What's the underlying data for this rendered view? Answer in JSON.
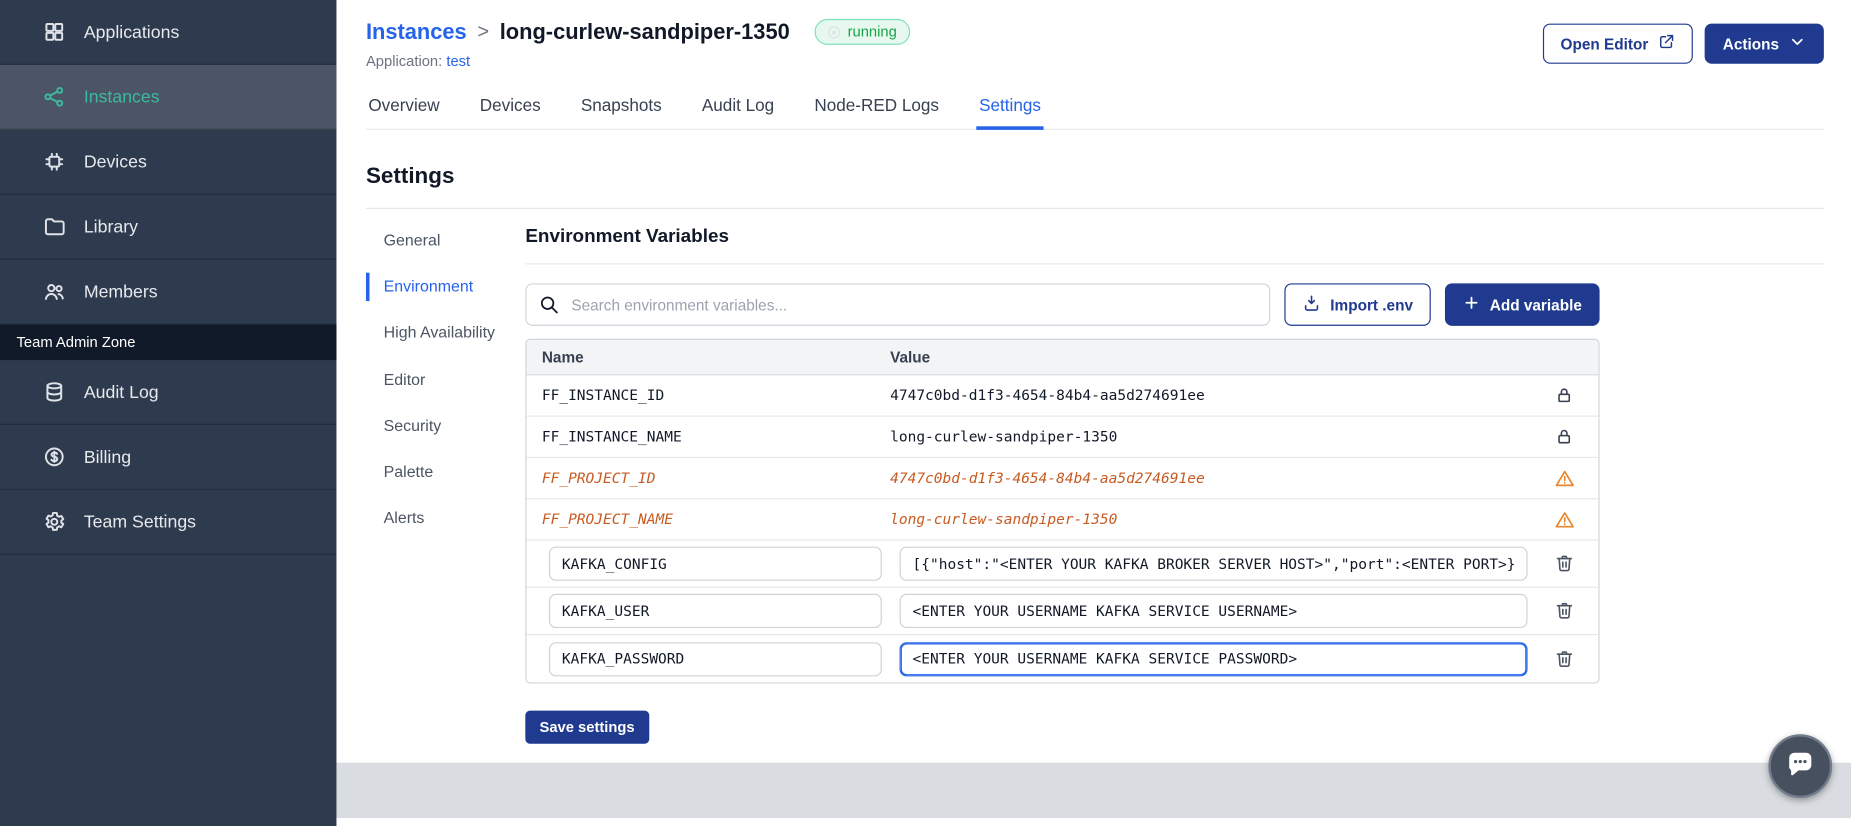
{
  "colors": {
    "primary": "#1f3a8f",
    "link": "#2563eb",
    "sidebar_bg": "#2e3a4d",
    "sidebar_active_bg": "#4b5565",
    "sidebar_active_text": "#3cb9a0",
    "band_bg": "#111a29",
    "deprecated_text": "#c75b21",
    "warning_icon": "#e8862d",
    "running_text": "#17a34a",
    "running_bg": "#e7f9ef",
    "running_border": "#7ee2b8",
    "chat_bg": "#47505f"
  },
  "sidebar": {
    "items": [
      {
        "label": "Applications",
        "icon": "applications",
        "active": false
      },
      {
        "label": "Instances",
        "icon": "instances",
        "active": true
      },
      {
        "label": "Devices",
        "icon": "devices",
        "active": false
      },
      {
        "label": "Library",
        "icon": "library",
        "active": false
      },
      {
        "label": "Members",
        "icon": "members",
        "active": false
      }
    ],
    "section_label": "Team Admin Zone",
    "admin_items": [
      {
        "label": "Audit Log",
        "icon": "audit-log",
        "active": false
      },
      {
        "label": "Billing",
        "icon": "billing",
        "active": false
      },
      {
        "label": "Team Settings",
        "icon": "team-settings",
        "active": false
      }
    ]
  },
  "header": {
    "breadcrumb_parent": "Instances",
    "breadcrumb_separator": ">",
    "instance_name": "long-curlew-sandpiper-1350",
    "status_badge": "running",
    "application_label": "Application:",
    "application_name": "test",
    "open_editor_label": "Open Editor",
    "actions_label": "Actions"
  },
  "tabs": [
    {
      "label": "Overview",
      "active": false
    },
    {
      "label": "Devices",
      "active": false
    },
    {
      "label": "Snapshots",
      "active": false
    },
    {
      "label": "Audit Log",
      "active": false
    },
    {
      "label": "Node-RED Logs",
      "active": false
    },
    {
      "label": "Settings",
      "active": true
    }
  ],
  "settings": {
    "page_title": "Settings",
    "nav": [
      {
        "label": "General",
        "active": false
      },
      {
        "label": "Environment",
        "active": true
      },
      {
        "label": "High Availability",
        "active": false
      },
      {
        "label": "Editor",
        "active": false
      },
      {
        "label": "Security",
        "active": false
      },
      {
        "label": "Palette",
        "active": false
      },
      {
        "label": "Alerts",
        "active": false
      }
    ],
    "section_title": "Environment Variables",
    "search_placeholder": "Search environment variables...",
    "import_button": "Import .env",
    "add_button": "Add variable",
    "save_button": "Save settings",
    "table": {
      "columns": [
        "Name",
        "Value"
      ],
      "rows": [
        {
          "name": "FF_INSTANCE_ID",
          "value": "4747c0bd-d1f3-4654-84b4-aa5d274691ee",
          "type": "locked"
        },
        {
          "name": "FF_INSTANCE_NAME",
          "value": "long-curlew-sandpiper-1350",
          "type": "locked"
        },
        {
          "name": "FF_PROJECT_ID",
          "value": "4747c0bd-d1f3-4654-84b4-aa5d274691ee",
          "type": "deprecated"
        },
        {
          "name": "FF_PROJECT_NAME",
          "value": "long-curlew-sandpiper-1350",
          "type": "deprecated"
        },
        {
          "name": "KAFKA_CONFIG",
          "value": "[{\"host\":\"<ENTER YOUR KAFKA BROKER SERVER HOST>\",\"port\":<ENTER PORT>}]",
          "type": "editable",
          "focused": false
        },
        {
          "name": "KAFKA_USER",
          "value": "<ENTER YOUR USERNAME KAFKA SERVICE USERNAME>",
          "type": "editable",
          "focused": false
        },
        {
          "name": "KAFKA_PASSWORD",
          "value": "<ENTER YOUR USERNAME KAFKA SERVICE PASSWORD>",
          "type": "editable",
          "focused": true
        }
      ]
    }
  }
}
